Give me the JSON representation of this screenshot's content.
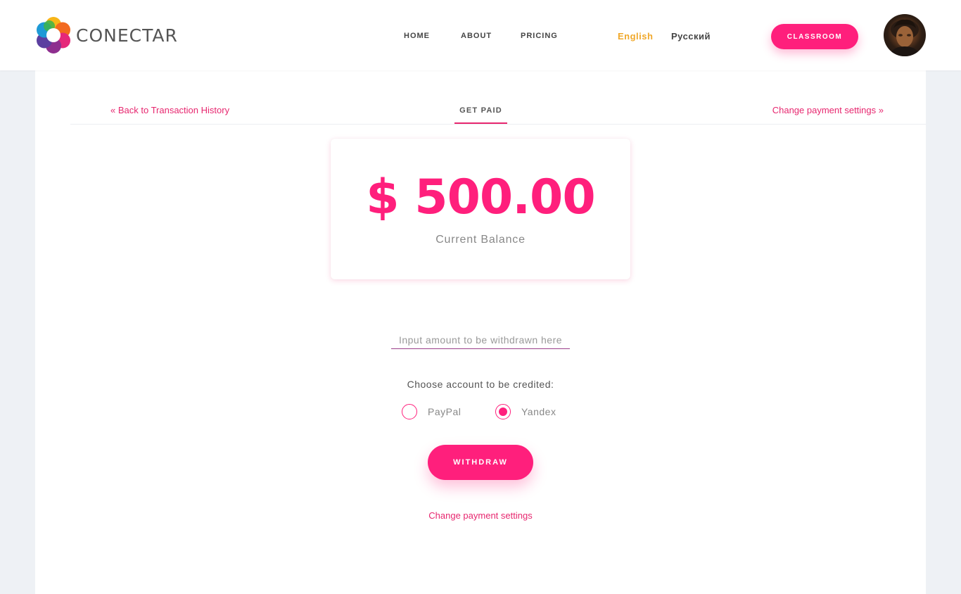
{
  "brand": {
    "name": "CONECTAR"
  },
  "nav": {
    "home": "HOME",
    "about": "ABOUT",
    "pricing": "PRICING"
  },
  "languages": {
    "english": "English",
    "russian": "Русский",
    "active_color": "#f0a82a"
  },
  "header": {
    "classroom_button": "CLASSROOM"
  },
  "subnav": {
    "back_link": "« Back to Transaction History",
    "active_tab": "GET PAID",
    "settings_link": "Change payment settings »"
  },
  "balance": {
    "amount": "$ 500.00",
    "label": "Current Balance"
  },
  "withdraw_form": {
    "amount_placeholder": "Input amount to be withdrawn here",
    "amount_value": "",
    "choose_account_label": "Choose account to be credited:",
    "accounts": [
      {
        "label": "PayPal",
        "selected": false
      },
      {
        "label": "Yandex",
        "selected": true
      }
    ],
    "submit_label": "WITHDRAW",
    "settings_link": "Change payment settings"
  },
  "colors": {
    "accent": "#ff1f7c",
    "link": "#e7276f",
    "background": "#eef1f5"
  }
}
